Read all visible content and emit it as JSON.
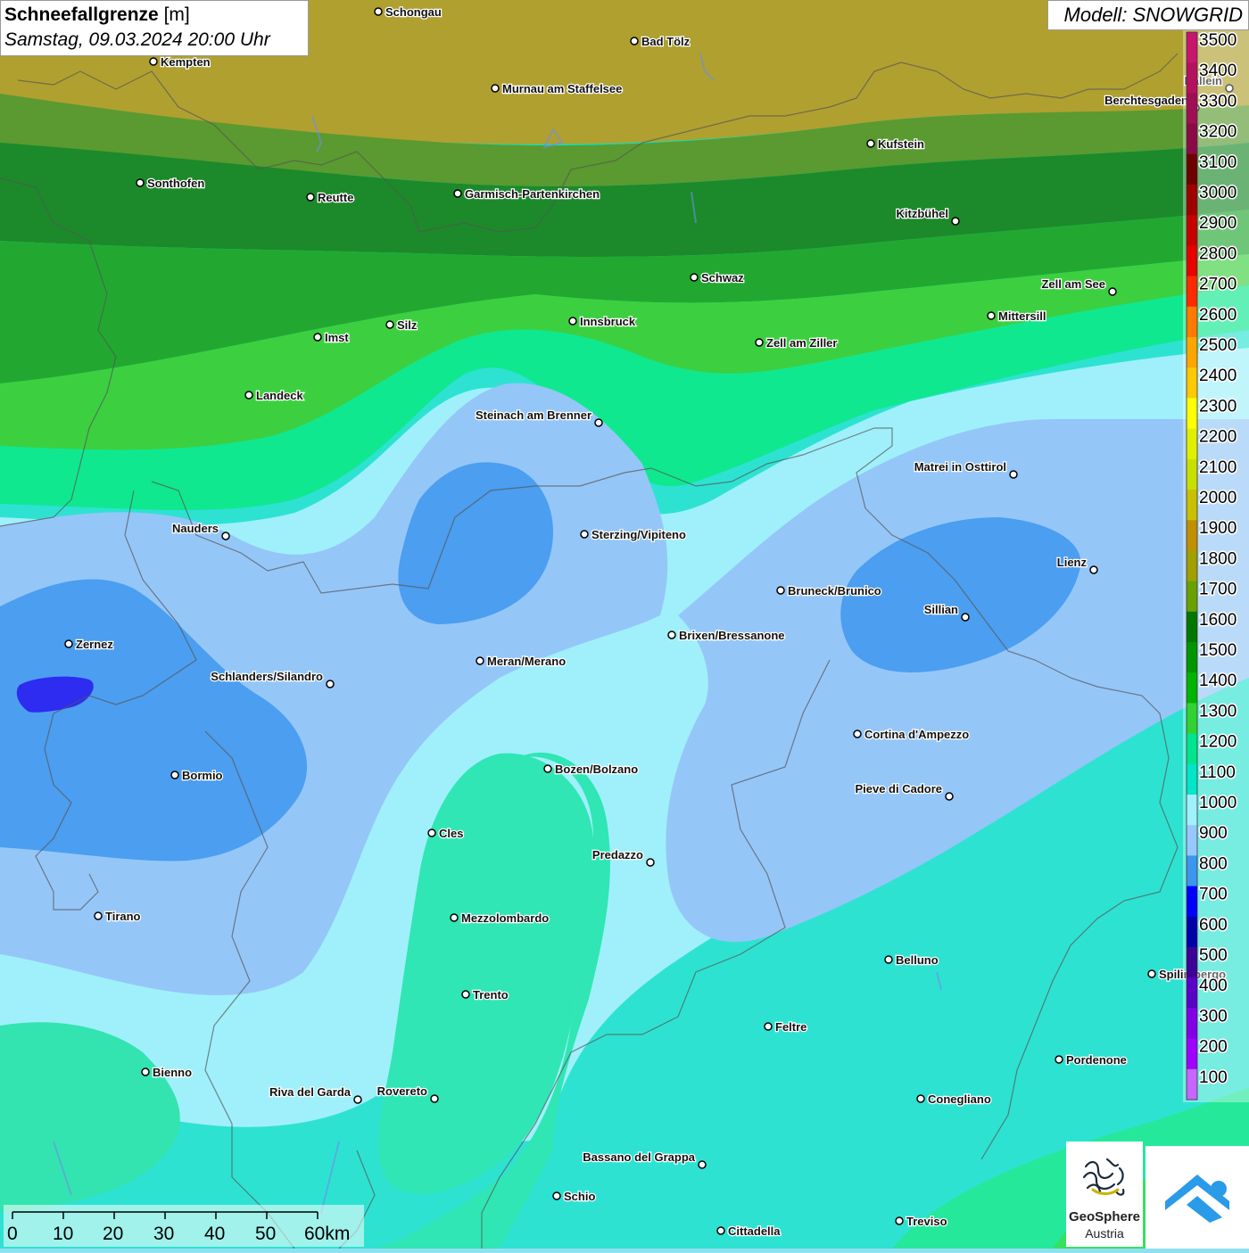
{
  "title": {
    "parameter": "Schneefallgrenze",
    "unit": "[m]",
    "datetime": "Samstag, 09.03.2024 20:00 Uhr"
  },
  "model": "Modell: SNOWGRID",
  "legend": {
    "entries": [
      {
        "value": "3500",
        "color": "#c8166e"
      },
      {
        "value": "3400",
        "color": "#b4125f"
      },
      {
        "value": "3300",
        "color": "#a00e54"
      },
      {
        "value": "3200",
        "color": "#8a0a46"
      },
      {
        "value": "3100",
        "color": "#6e0000"
      },
      {
        "value": "3000",
        "color": "#a00000"
      },
      {
        "value": "2900",
        "color": "#c80000"
      },
      {
        "value": "2800",
        "color": "#e80000"
      },
      {
        "value": "2700",
        "color": "#ff2a00"
      },
      {
        "value": "2600",
        "color": "#ff7a00"
      },
      {
        "value": "2500",
        "color": "#ffa500"
      },
      {
        "value": "2400",
        "color": "#ffc800"
      },
      {
        "value": "2300",
        "color": "#ffff00"
      },
      {
        "value": "2200",
        "color": "#e0f000"
      },
      {
        "value": "2100",
        "color": "#c8e000"
      },
      {
        "value": "2000",
        "color": "#c8c000"
      },
      {
        "value": "1900",
        "color": "#c09000"
      },
      {
        "value": "1800",
        "color": "#a0a000"
      },
      {
        "value": "1700",
        "color": "#6aa000"
      },
      {
        "value": "1600",
        "color": "#007800"
      },
      {
        "value": "1500",
        "color": "#009600"
      },
      {
        "value": "1400",
        "color": "#00b400"
      },
      {
        "value": "1300",
        "color": "#32d232"
      },
      {
        "value": "1200",
        "color": "#00e68c"
      },
      {
        "value": "1100",
        "color": "#00e6c8"
      },
      {
        "value": "1000",
        "color": "#a0f0ff"
      },
      {
        "value": "900",
        "color": "#96c8ff"
      },
      {
        "value": "800",
        "color": "#3c96f0"
      },
      {
        "value": "700",
        "color": "#0000ff"
      },
      {
        "value": "600",
        "color": "#0000aa"
      },
      {
        "value": "500",
        "color": "#3c0096"
      },
      {
        "value": "400",
        "color": "#5a00c8"
      },
      {
        "value": "300",
        "color": "#8200e6"
      },
      {
        "value": "200",
        "color": "#a000ff"
      },
      {
        "value": "100",
        "color": "#c864ff"
      }
    ]
  },
  "cities": [
    {
      "name": "Schongau"
    },
    {
      "name": "Bad Tölz"
    },
    {
      "name": "Kempten"
    },
    {
      "name": "Murnau am Staffelsee"
    },
    {
      "name": "Hallein"
    },
    {
      "name": "Berchtesgaden"
    },
    {
      "name": "Kufstein"
    },
    {
      "name": "Sonthofen"
    },
    {
      "name": "Reutte"
    },
    {
      "name": "Garmisch-Partenkirchen"
    },
    {
      "name": "Kitzbühel"
    },
    {
      "name": "Schwaz"
    },
    {
      "name": "Zell am See"
    },
    {
      "name": "Mittersill"
    },
    {
      "name": "Innsbruck"
    },
    {
      "name": "Silz"
    },
    {
      "name": "Imst"
    },
    {
      "name": "Zell am Ziller"
    },
    {
      "name": "Landeck"
    },
    {
      "name": "Steinach am Brenner"
    },
    {
      "name": "Matrei in Osttirol"
    },
    {
      "name": "Nauders"
    },
    {
      "name": "Sterzing/Vipiteno"
    },
    {
      "name": "Lienz"
    },
    {
      "name": "Bruneck/Brunico"
    },
    {
      "name": "Sillian"
    },
    {
      "name": "Brixen/Bressanone"
    },
    {
      "name": "Zernez"
    },
    {
      "name": "Meran/Merano"
    },
    {
      "name": "Schlanders/Silandro"
    },
    {
      "name": "Cortina d'Ampezzo"
    },
    {
      "name": "Bozen/Bolzano"
    },
    {
      "name": "Bormio"
    },
    {
      "name": "Pieve di Cadore"
    },
    {
      "name": "Cles"
    },
    {
      "name": "Predazzo"
    },
    {
      "name": "Tirano"
    },
    {
      "name": "Mezzolombardo"
    },
    {
      "name": "Belluno"
    },
    {
      "name": "Spilimbergo"
    },
    {
      "name": "Trento"
    },
    {
      "name": "Feltre"
    },
    {
      "name": "Pordenone"
    },
    {
      "name": "Bienno"
    },
    {
      "name": "Riva del Garda"
    },
    {
      "name": "Rovereto"
    },
    {
      "name": "Conegliano"
    },
    {
      "name": "Bassano del Grappa"
    },
    {
      "name": "Schio"
    },
    {
      "name": "Treviso"
    },
    {
      "name": "Cittadella"
    }
  ],
  "scale_bar": {
    "ticks": [
      "0",
      "10",
      "20",
      "30",
      "40",
      "50",
      "60km"
    ]
  },
  "logos": {
    "geosphere_line1": "GeoSphere",
    "geosphere_line2": "Austria"
  },
  "icons": [
    "geosphere-logo-icon",
    "app-logo-icon"
  ]
}
